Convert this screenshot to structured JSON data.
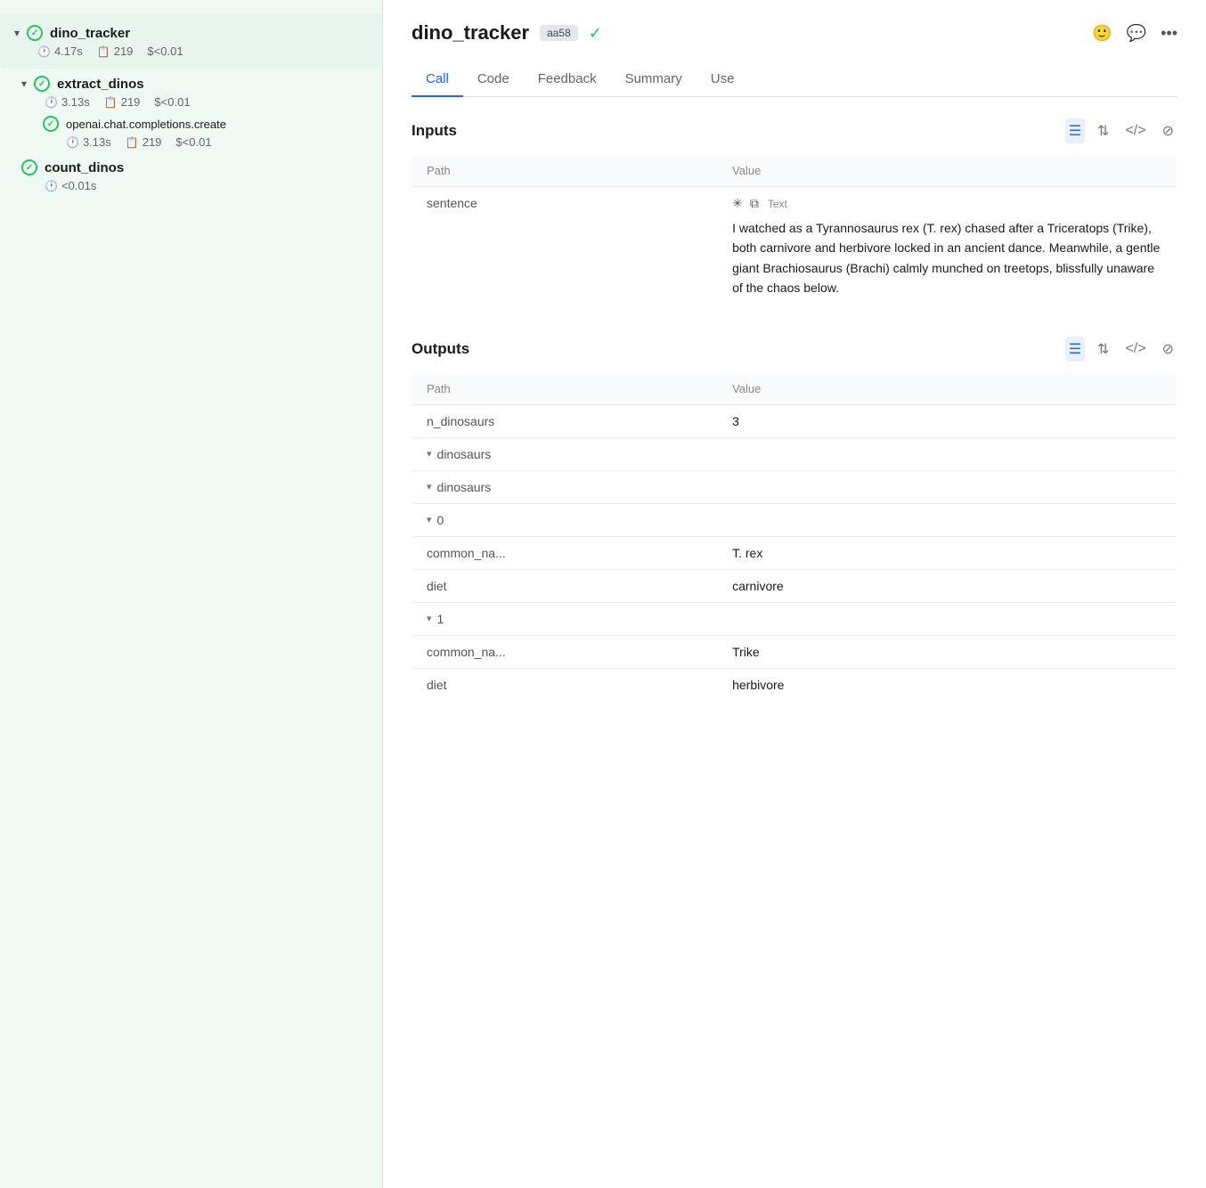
{
  "sidebar": {
    "items": [
      {
        "name": "dino_tracker",
        "level": 0,
        "expanded": true,
        "status": "success",
        "time": "4.17s",
        "tokens": "219",
        "cost": "$<0.01"
      },
      {
        "name": "extract_dinos",
        "level": 1,
        "expanded": true,
        "status": "success",
        "time": "3.13s",
        "tokens": "219",
        "cost": "$<0.01"
      },
      {
        "name": "openai.chat.completions.create",
        "level": 2,
        "expanded": false,
        "status": "success",
        "time": "3.13s",
        "tokens": "219",
        "cost": "$<0.01"
      },
      {
        "name": "count_dinos",
        "level": 1,
        "expanded": false,
        "status": "success",
        "time": "<0.01s",
        "tokens": null,
        "cost": null
      }
    ]
  },
  "header": {
    "title": "dino_tracker",
    "badge": "aa58",
    "icons": {
      "emoji": "😊",
      "chat": "💬",
      "more": "···"
    }
  },
  "tabs": [
    {
      "label": "Call",
      "active": true
    },
    {
      "label": "Code",
      "active": false
    },
    {
      "label": "Feedback",
      "active": false
    },
    {
      "label": "Summary",
      "active": false
    },
    {
      "label": "Use",
      "active": false
    }
  ],
  "inputs": {
    "section_title": "Inputs",
    "columns": {
      "path": "Path",
      "value": "Value"
    },
    "rows": [
      {
        "path": "sentence",
        "value_label": "Text",
        "value_text": "I watched as a Tyrannosaurus rex (T. rex) chased after a Triceratops (Trike), both carnivore and herbivore locked in an ancient dance. Meanwhile, a gentle giant Brachiosaurus (Brachi) calmly munched on treetops, blissfully unaware of the chaos below."
      }
    ]
  },
  "outputs": {
    "section_title": "Outputs",
    "columns": {
      "path": "Path",
      "value": "Value"
    },
    "rows": [
      {
        "indent": 0,
        "path": "n_dinosaurs",
        "value": "3",
        "expandable": false
      },
      {
        "indent": 0,
        "path": "dinosaurs",
        "value": "",
        "expandable": true,
        "expanded": true
      },
      {
        "indent": 1,
        "path": "dinosaurs",
        "value": "",
        "expandable": true,
        "expanded": true
      },
      {
        "indent": 2,
        "path": "0",
        "value": "",
        "expandable": true,
        "expanded": true
      },
      {
        "indent": 3,
        "path": "common_na...",
        "value": "T. rex",
        "expandable": false
      },
      {
        "indent": 3,
        "path": "diet",
        "value": "carnivore",
        "expandable": false
      },
      {
        "indent": 2,
        "path": "1",
        "value": "",
        "expandable": true,
        "expanded": true
      },
      {
        "indent": 3,
        "path": "common_na...",
        "value": "Trike",
        "expandable": false
      },
      {
        "indent": 3,
        "path": "diet",
        "value": "herbivore",
        "expandable": false
      }
    ]
  },
  "icons": {
    "list": "☰",
    "sort": "⇅",
    "code": "</>",
    "hide": "⊘"
  }
}
